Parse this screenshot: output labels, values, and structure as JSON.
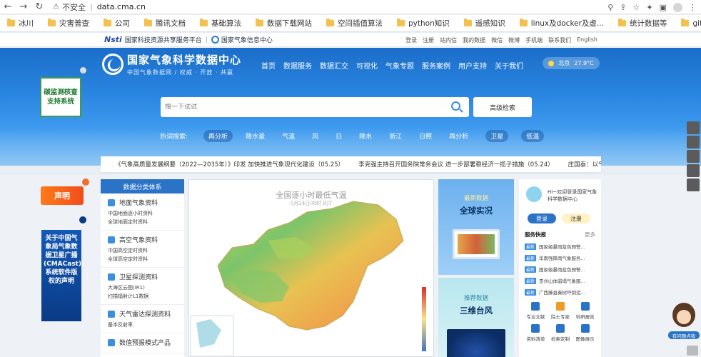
{
  "browser": {
    "insecure_label": "不安全",
    "url": "data.cma.cn",
    "bookmarks": [
      "冰川",
      "灾害普查",
      "公司",
      "腾讯文档",
      "基础算法",
      "数据下载网站",
      "空间插值算法",
      "python知识",
      "遥感知识",
      "linux及docker及虚...",
      "统计数据等",
      "git"
    ]
  },
  "util": {
    "partner1": "国家科技资源共享服务平台",
    "partner2": "国家气象信息中心",
    "links": [
      "登录",
      "注册",
      "站内信",
      "我的数据",
      "微信",
      "微博",
      "手机端",
      "联系我们",
      "English"
    ]
  },
  "header": {
    "title": "国家气象科学数据中心",
    "subtitle": "中国气象数据网 / 权威 · 开放 · 共赢",
    "nav": [
      "首页",
      "数据服务",
      "数据汇交",
      "可视化",
      "气象专题",
      "服务案例",
      "用户支持",
      "关于我们"
    ],
    "weather": {
      "city": "北京",
      "temp": "27.9°C"
    }
  },
  "search": {
    "placeholder": "搜一下试试",
    "advanced": "高级检索"
  },
  "hot": {
    "label": "热词搜索:",
    "keywords": [
      "再分析",
      "降水量",
      "气温",
      "风",
      "日",
      "降水",
      "浙江",
      "日照",
      "再分析",
      "卫星",
      "低温"
    ]
  },
  "carbon": {
    "line1": "碳监测核查",
    "line2": "支持系统"
  },
  "news": [
    "《气象高质量发展纲要（2022—2035年）》印发 加快推进气象现代化建设（05.25）",
    "李克强主持召开国务院常务会议 进一步部署稳经济一揽子措施（05.24）",
    "庄国泰：以气象高质量"
  ],
  "categories": {
    "title": "数据分类体系",
    "groups": [
      {
        "name": "地面气象资料",
        "subs": [
          "中国地面逐小时资料",
          "全球地面定时资料"
        ]
      },
      {
        "name": "高空气象资料",
        "subs": [
          "中国高空定时资料",
          "全球高空定时资料"
        ]
      },
      {
        "name": "卫星探测资料",
        "subs": [
          "大海区云图(IR1)",
          "扫描辐射计L1数据"
        ]
      },
      {
        "name": "天气雷达探测资料",
        "subs": [
          "基本反射率"
        ]
      },
      {
        "name": "数值预报模式产品",
        "subs": []
      }
    ]
  },
  "map": {
    "title": "全国逐小时最低气温",
    "subtitle": "5月24日08时    BJT"
  },
  "promo1": {
    "label": "最新数据",
    "title": "全球实况"
  },
  "promo2": {
    "label": "推荐数据",
    "title": "三维台风"
  },
  "login": {
    "greeting": "HI~欢迎登录国家气象科学数据中心",
    "login_btn": "登录",
    "register_btn": "注册",
    "services_title": "服务快报",
    "more": "更多",
    "new_tag": "最新",
    "services": [
      "国家级暴雨蓝色预警...",
      "华南强降雨气象服务...",
      "国家级暴雨蓝色预警...",
      "贵州山体崩塌气象服...",
      "广西藤县秦树坏倒泥..."
    ],
    "tools": [
      "专业文献",
      "院士专家",
      "科研报告",
      "资料清单",
      "检索定制",
      "图像展示"
    ]
  },
  "shengming": "声明",
  "cmacast": "关于中国气象局气象数据卫星广播(CMACast)系统软件版权的声明",
  "assistant": "有问题点我"
}
